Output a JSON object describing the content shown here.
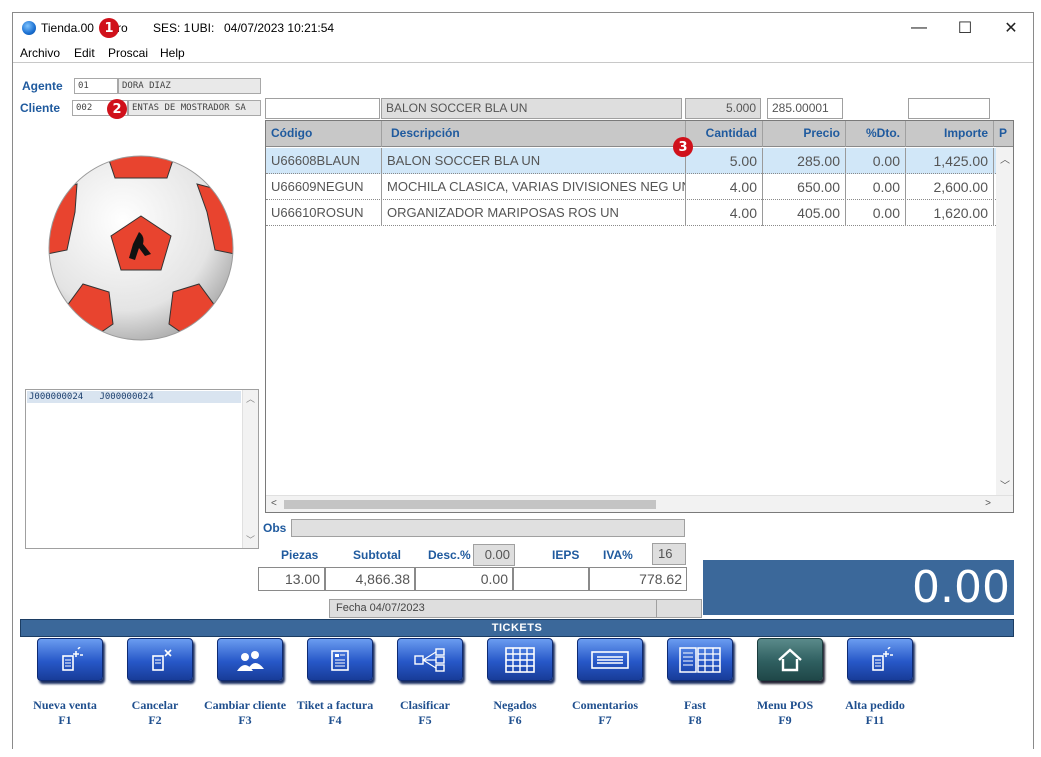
{
  "window": {
    "app_name": "Tienda.00",
    "module": "ro",
    "session": "SES: 1",
    "location": "UBI:",
    "datetime": "04/07/2023 10:21:54",
    "controls": {
      "minimize": "—",
      "maximize": "☐",
      "close": "✕"
    }
  },
  "badges": [
    "1",
    "2",
    "3"
  ],
  "menu": [
    "Archivo",
    "Edit",
    "Proscai",
    "Help"
  ],
  "agente": {
    "label": "Agente",
    "code": "01",
    "name": "DORA DIAZ"
  },
  "cliente": {
    "label": "Cliente",
    "code": "002",
    "name": "ENTAS DE MOSTRADOR SA"
  },
  "entry": {
    "code": "",
    "description": "BALON SOCCER BLA UN",
    "quantity": "5.000",
    "price": "285.00001",
    "extra": ""
  },
  "ticket_list": {
    "row": "J000000024   J000000024"
  },
  "grid": {
    "columns": [
      {
        "key": "codigo",
        "label": "Código"
      },
      {
        "key": "descripcion",
        "label": "Descripción"
      },
      {
        "key": "cantidad",
        "label": "Cantidad"
      },
      {
        "key": "precio",
        "label": "Precio"
      },
      {
        "key": "dto",
        "label": "%Dto."
      },
      {
        "key": "importe",
        "label": "Importe"
      },
      {
        "key": "extra",
        "label": "P"
      }
    ],
    "rows": [
      {
        "codigo": "U66608BLAUN",
        "descripcion": "BALON SOCCER BLA UN",
        "cantidad": "5.00",
        "precio": "285.00",
        "dto": "0.00",
        "importe": "1,425.00"
      },
      {
        "codigo": "U66609NEGUN",
        "descripcion": "MOCHILA CLASICA, VARIAS DIVISIONES NEG UN",
        "cantidad": "4.00",
        "precio": "650.00",
        "dto": "0.00",
        "importe": "2,600.00"
      },
      {
        "codigo": "U66610ROSUN",
        "descripcion": "ORGANIZADOR MARIPOSAS ROS UN",
        "cantidad": "4.00",
        "precio": "405.00",
        "dto": "0.00",
        "importe": "1,620.00"
      }
    ],
    "selected_row": 0
  },
  "obs": {
    "label": "Obs",
    "value": ""
  },
  "totals": {
    "piezas_label": "Piezas",
    "subtotal_label": "Subtotal",
    "desc_label": "Desc.%",
    "desc_pct": "0.00",
    "ieps_label": "IEPS",
    "iva_label": "IVA%",
    "iva_pct": "16",
    "piezas": "13.00",
    "subtotal": "4,866.38",
    "descuento": "0.00",
    "ieps": "",
    "iva": "778.62",
    "fecha": "Fecha 04/07/2023",
    "total": "0.00"
  },
  "tickets_title": "TICKETS",
  "buttons": [
    {
      "label": "Nueva venta",
      "key": "F1",
      "icon": "new-sale-icon"
    },
    {
      "label": "Cancelar",
      "key": "F2",
      "icon": "cancel-ticket-icon"
    },
    {
      "label": "Cambiar cliente",
      "key": "F3",
      "icon": "users-icon"
    },
    {
      "label": "Tiket a factura",
      "key": "F4",
      "icon": "invoice-icon"
    },
    {
      "label": "Clasificar",
      "key": "F5",
      "icon": "classify-icon"
    },
    {
      "label": "Negados",
      "key": "F6",
      "icon": "grid-icon"
    },
    {
      "label": "Comentarios",
      "key": "F7",
      "icon": "comments-icon"
    },
    {
      "label": "Fast",
      "key": "F8",
      "icon": "table-icon"
    },
    {
      "label": "Menu POS",
      "key": "F9",
      "icon": "home-icon"
    },
    {
      "label": "Alta pedido",
      "key": "F11",
      "icon": "new-order-icon"
    }
  ],
  "colors": {
    "accent_blue": "#1f5a9e",
    "header_bar": "#3b689a",
    "selection": "#d1e7f8",
    "badge": "#d0111b"
  }
}
